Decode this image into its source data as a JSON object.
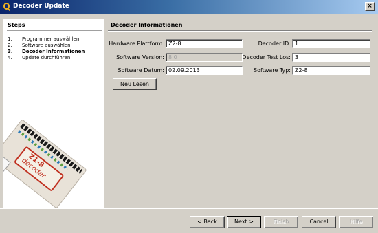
{
  "window": {
    "title": "Decoder Update",
    "close_glyph": "×"
  },
  "steps": {
    "title": "Steps",
    "items": [
      {
        "num": "1.",
        "label": "Programmer auswählen"
      },
      {
        "num": "2.",
        "label": "Software auswählen"
      },
      {
        "num": "3.",
        "label": "Decoder Informationen"
      },
      {
        "num": "4.",
        "label": "Update durchführen"
      }
    ],
    "image": {
      "model": "Z1-8",
      "brand": "decoder"
    }
  },
  "content": {
    "title": "Decoder Informationen",
    "hardware_plattform": {
      "label": "Hardware Plattform:",
      "value": "Z2-8"
    },
    "decoder_id": {
      "label": "Decoder ID:",
      "value": "1"
    },
    "software_version": {
      "label": "Software Version:",
      "value": "8.0"
    },
    "decoder_test_los": {
      "label": "Decoder Test Los:",
      "value": "3"
    },
    "software_datum": {
      "label": "Software Datum:",
      "value": "02.09.2013"
    },
    "software_typ": {
      "label": "Software Typ:",
      "value": "Z2-8"
    },
    "neu_lesen": "Neu Lesen"
  },
  "buttons": {
    "back": "< Back",
    "next": "Next >",
    "finish": "Finish",
    "cancel": "Cancel",
    "hilfe": "Hilfe"
  }
}
